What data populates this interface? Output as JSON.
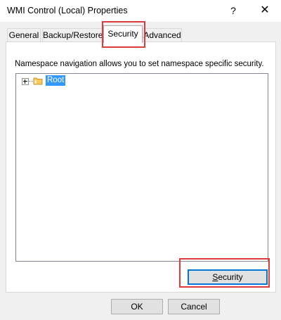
{
  "window": {
    "title": "WMI Control (Local) Properties",
    "help_label": "?",
    "close_label": "✕"
  },
  "tabs": [
    {
      "label": "General"
    },
    {
      "label": "Backup/Restore"
    },
    {
      "label": "Security",
      "active": true
    },
    {
      "label": "Advanced"
    }
  ],
  "security_panel": {
    "description": "Namespace navigation allows you to set namespace specific security.",
    "tree": {
      "root_label": "Root",
      "expander_icon": "plus-expander-icon",
      "folder_icon": "folder-icon"
    },
    "security_button": {
      "label_first": "S",
      "label_rest": "ecurity"
    }
  },
  "footer": {
    "ok_label": "OK",
    "cancel_label": "Cancel"
  },
  "colors": {
    "highlight": "#e03b3b",
    "selection": "#3399ff",
    "focus_border": "#0078d7"
  }
}
